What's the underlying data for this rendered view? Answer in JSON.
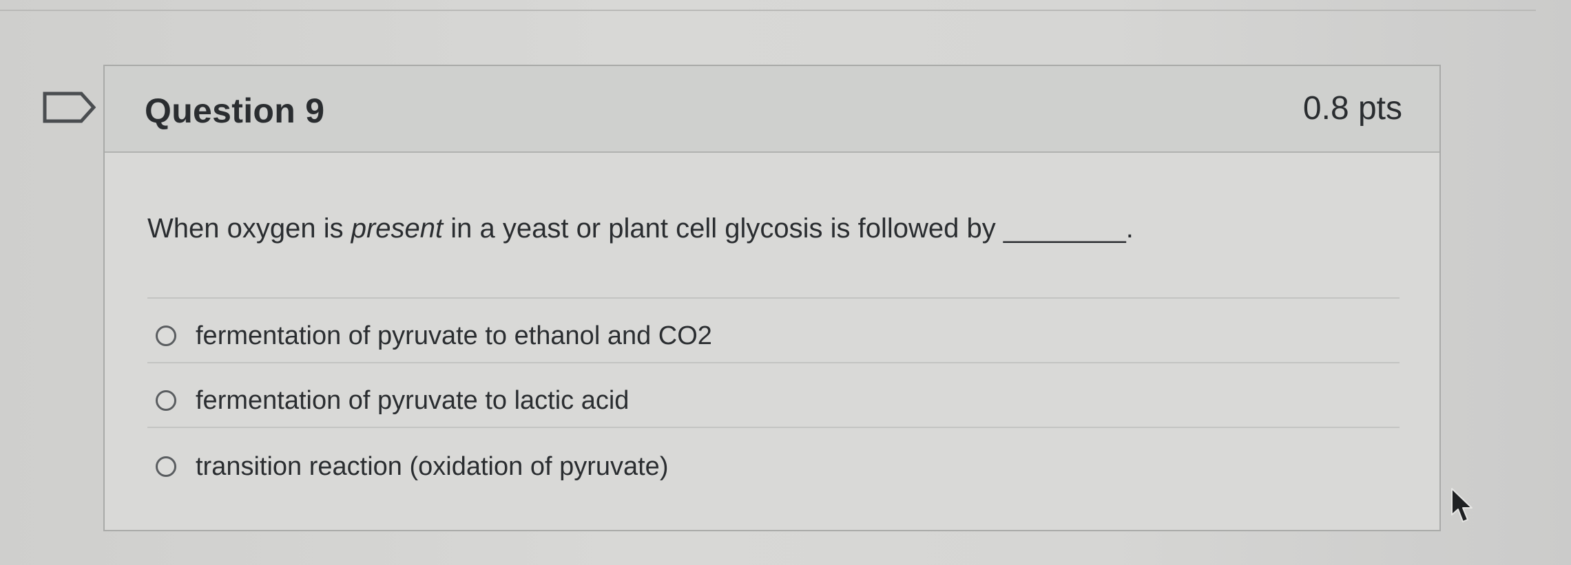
{
  "question": {
    "title": "Question 9",
    "points": "0.8 pts",
    "text_before": "When oxygen is ",
    "text_emphasis": "present",
    "text_after": " in a yeast or plant cell glycosis is followed by ________.",
    "answers": [
      {
        "label": "fermentation of pyruvate to ethanol and CO2",
        "selected": false
      },
      {
        "label": "fermentation of pyruvate to lactic acid",
        "selected": false
      },
      {
        "label": "transition reaction (oxidation of pyruvate)",
        "selected": false
      }
    ]
  },
  "icons": {
    "flag": "flag-question-icon",
    "cursor": "mouse-pointer-icon"
  },
  "colors": {
    "background": "#d6d6d4",
    "card_header": "#cfd0ce",
    "text": "#2a2d30",
    "border": "#a9aaa8"
  }
}
